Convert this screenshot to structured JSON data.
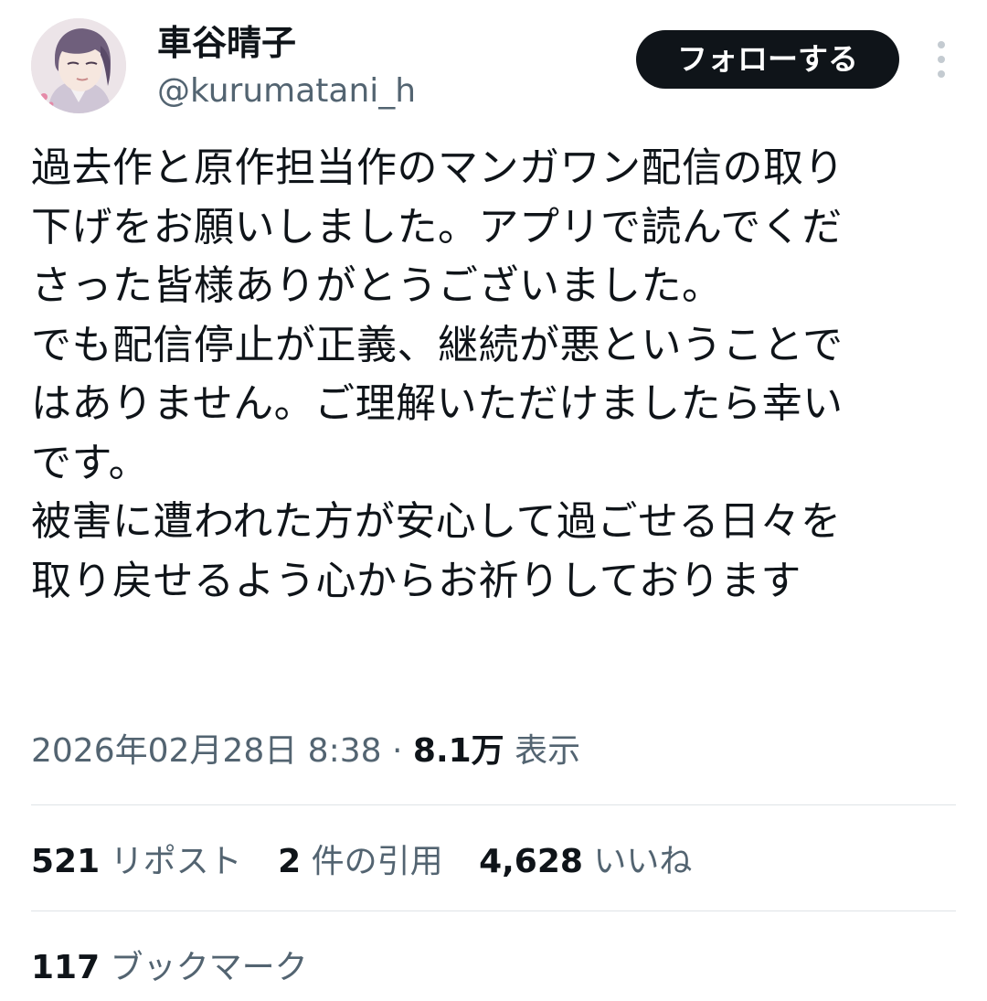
{
  "user": {
    "display_name": "車谷晴子",
    "handle": "@kurumatani_h",
    "avatar": "avatar-illustration"
  },
  "actions": {
    "follow_label": "フォローする",
    "more_icon": "more-vertical-icon"
  },
  "tweet": {
    "lines": [
      "過去作と原作担当作のマンガワン配信の取り",
      "下げをお願いしました。アプリで読んでくだ",
      "さった皆様ありがとうございました。",
      "でも配信停止が正義、継続が悪ということで",
      "はありません。ご理解いただけましたら幸い",
      "です。",
      "被害に遭われた方が安心して過ごせる日々を",
      "取り戻せるよう心からお祈りしております"
    ]
  },
  "meta": {
    "timestamp": "2026年02月28日 8:38",
    "separator": "·",
    "views_count": "8.1万",
    "views_label": "表示"
  },
  "stats": {
    "reposts_count": "521",
    "reposts_label": "リポスト",
    "quotes_count": "2",
    "quotes_label": "件の引用",
    "likes_count": "4,628",
    "likes_label": "いいね",
    "bookmarks_count": "117",
    "bookmarks_label": "ブックマーク"
  },
  "colors": {
    "text_primary": "#0f1419",
    "text_secondary": "#536471",
    "button_bg": "#0f1419",
    "divider": "#dfe3e6"
  }
}
